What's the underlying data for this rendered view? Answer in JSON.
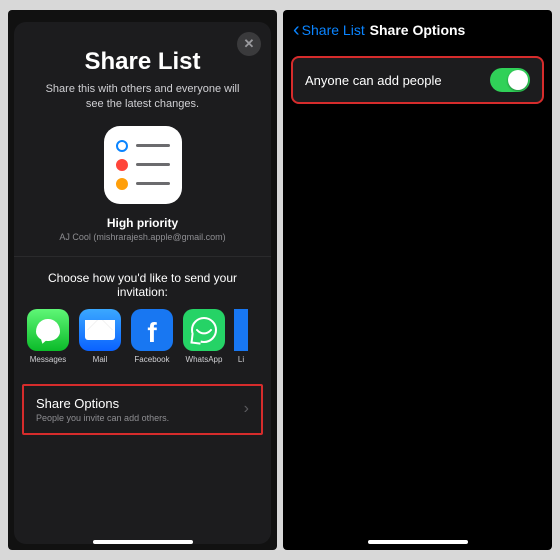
{
  "left": {
    "title": "Share List",
    "subtitle": "Share this with others and everyone will see the latest changes.",
    "list_name": "High priority",
    "list_owner": "AJ Cool (mishrarajesh.apple@gmail.com)",
    "choose_text": "Choose how you'd like to send your invitation:",
    "apps": [
      "Messages",
      "Mail",
      "Facebook",
      "WhatsApp",
      "Li"
    ],
    "options_title": "Share Options",
    "options_sub": "People you invite can add others."
  },
  "right": {
    "back_label": "Share List",
    "nav_title": "Share Options",
    "toggle_label": "Anyone can add people",
    "toggle_on": true
  }
}
